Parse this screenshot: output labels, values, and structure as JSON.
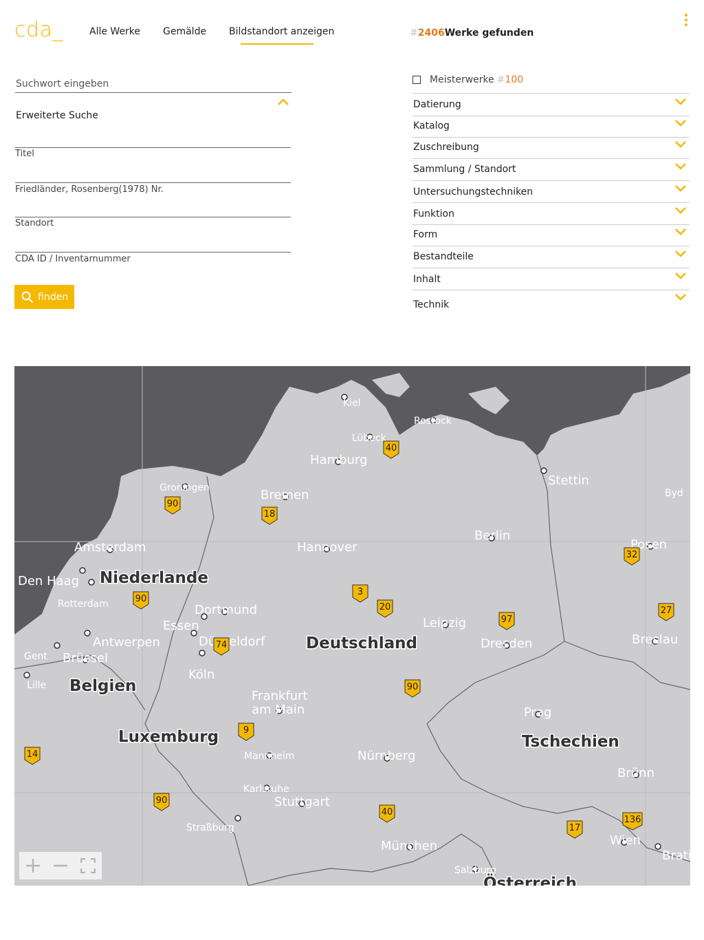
{
  "header": {
    "logo": "cda_",
    "nav": [
      "Alle Werke",
      "Gemälde",
      "Bildstandort anzeigen"
    ],
    "results_hash": "#",
    "results_count": "2406",
    "results_label": "Werke gefunden",
    "menu_icon": "kebab-menu-icon"
  },
  "search": {
    "placeholder": "Suchwort eingeben",
    "advanced_label": "Erweiterte Suche",
    "advanced_toggle_icon": "chevron-up-icon",
    "fields": [
      "Titel",
      "Friedländer, Rosenberg(1978) Nr.",
      "Standort",
      "CDA ID / Inventarnummer"
    ],
    "find_label": "finden",
    "find_icon": "search-icon"
  },
  "filters": {
    "meister_label": "Meisterwerke",
    "meister_hash": "#",
    "meister_count": "100",
    "items": [
      "Datierung",
      "Katalog",
      "Zuschreibung",
      "Sammlung / Standort",
      "Untersuchungstechniken",
      "Funktion",
      "Form",
      "Bestandteile",
      "Inhalt",
      "Technik"
    ],
    "item_icon": "chevron-down-icon"
  },
  "map": {
    "countries": [
      "Niederlande",
      "Deutschland",
      "Belgien",
      "Luxemburg",
      "Tschechien",
      "Österreich"
    ],
    "cities": [
      "Kiel",
      "Rostock",
      "Lübeck",
      "Hamburg",
      "Stettin",
      "Groningen",
      "Bremen",
      "Byd",
      "Amsterdam",
      "Hannover",
      "Berlin",
      "Posen",
      "Den Haag",
      "Rotterdam",
      "Dortmund",
      "Essen",
      "Düsseldorf",
      "Leipzig",
      "Dresden",
      "Breslau",
      "Antwerpen",
      "Gent",
      "Brüssel",
      "Köln",
      "Lille",
      "Frankfurt am Main",
      "Prag",
      "Mannheim",
      "Nürnberg",
      "Brünn",
      "Karlsruhe",
      "Stuttgart",
      "Straßburg",
      "München",
      "Salzburg",
      "Wien",
      "Brati"
    ],
    "markers": [
      "40",
      "90",
      "18",
      "32",
      "90",
      "3",
      "20",
      "97",
      "27",
      "74",
      "90",
      "9",
      "14",
      "90",
      "40",
      "17",
      "136"
    ],
    "controls": [
      "zoom-in-icon",
      "zoom-out-icon",
      "fullscreen-icon"
    ],
    "colors": {
      "land": "#cdcdd0",
      "sea": "#5b5b5e",
      "marker": "#f5b800",
      "text_light": "#ffffff"
    }
  },
  "colors": {
    "accent": "#f5b800",
    "count": "#e07a1a"
  }
}
